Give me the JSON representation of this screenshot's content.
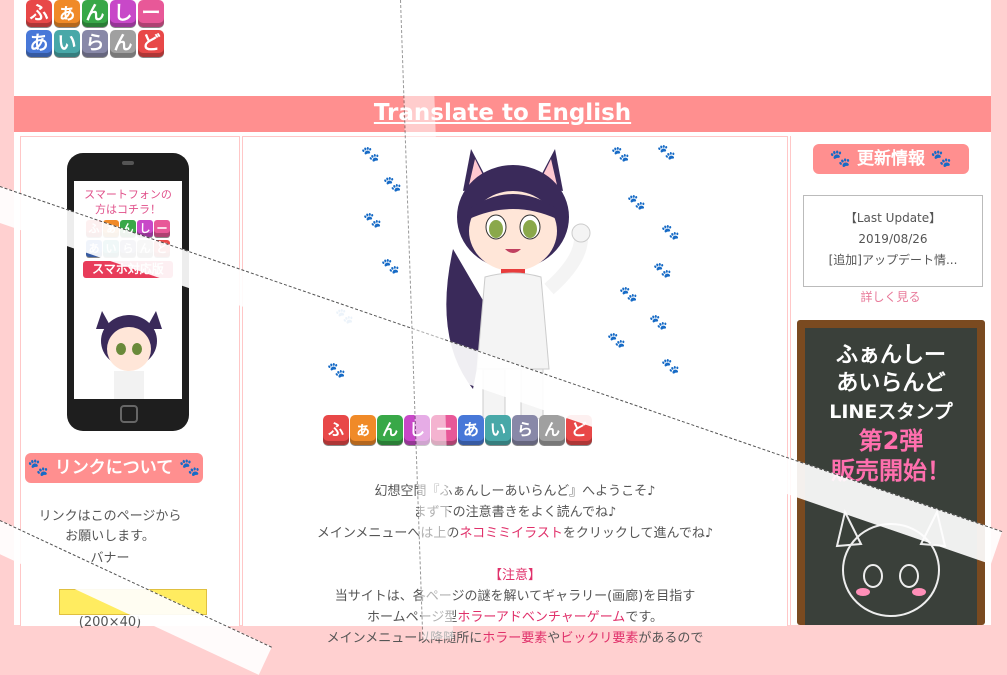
{
  "translate": {
    "label": "Translate to English"
  },
  "logo": {
    "row1": [
      "ふ",
      "ぁ",
      "ん",
      "し",
      "ー"
    ],
    "row2": [
      "あ",
      "い",
      "ら",
      "ん",
      "ど"
    ],
    "colors1": [
      "#e84848",
      "#f08a28",
      "#38a848",
      "#c848c8",
      "#e85898"
    ],
    "colors2": [
      "#4878d8",
      "#48a8a8",
      "#8888a8",
      "#a0a0a0",
      "#e84848"
    ]
  },
  "left": {
    "phone_text": [
      "スマートフォンの",
      "方はコチラ！"
    ],
    "phone_badge": "スマホ対応版",
    "link_title": "リンクについて",
    "link_lines": [
      "リンクはこのページから",
      "お願いします。",
      "バナー",
      "(200×40)"
    ]
  },
  "mid": {
    "logo_text": [
      "ふ",
      "ぁ",
      "ん",
      "し",
      "ー",
      "あ",
      "い",
      "ら",
      "ん",
      "ど"
    ],
    "intro_lines": [
      "幻想空間『ふぁんしーあいらんど』へようこそ♪",
      "まず下の注意書きをよく読んでね♪",
      "メインメニューへは上のネコミミイラストをクリックして進んでね♪",
      "",
      "【注意】",
      "当サイトは、各ページの謎を解いてギャラリー(画廊)を目指す",
      "ホームページ型ホラーアドベンチャーゲームです。",
      "メインメニュー以降随所にホラー要素やビックリ要素があるので"
    ]
  },
  "right": {
    "news_title": "更新情報",
    "news": [
      "【Last Update】",
      "2019/08/26",
      "[追加]アップデート情..."
    ],
    "more": "詳しく見る",
    "board": [
      "ふぁんしー",
      "あいらんど",
      "LINEスタンプ",
      "第2弾",
      "販売開始！"
    ]
  },
  "colors": {
    "accent": "#ff8f8f",
    "bg": "#ffd0d0",
    "highlight": "#e0306a"
  }
}
